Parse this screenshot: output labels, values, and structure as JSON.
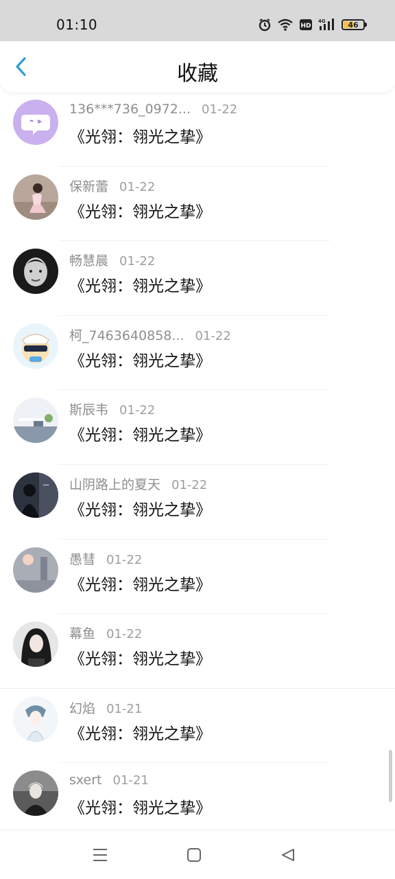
{
  "status_bar": {
    "time": "01:10",
    "battery_level": "46",
    "icons": [
      "alarm-icon",
      "wifi-icon",
      "hd-icon",
      "signal-4g-icon",
      "battery-icon"
    ]
  },
  "header": {
    "title": "收藏",
    "back_icon": "chevron-left-icon",
    "accent_color": "#2d9cdb"
  },
  "list": {
    "items": [
      {
        "name": "136***736_0972...",
        "date": "01-22",
        "work": "《光翎：翎光之挚》"
      },
      {
        "name": "保新蕾",
        "date": "01-22",
        "work": "《光翎：翎光之挚》"
      },
      {
        "name": "畅慧晨",
        "date": "01-22",
        "work": "《光翎：翎光之挚》"
      },
      {
        "name": "柯_7463640858...",
        "date": "01-22",
        "work": "《光翎：翎光之挚》"
      },
      {
        "name": "斯辰韦",
        "date": "01-22",
        "work": "《光翎：翎光之挚》"
      },
      {
        "name": "山阴路上的夏天",
        "date": "01-22",
        "work": "《光翎：翎光之挚》"
      },
      {
        "name": "愚彗",
        "date": "01-22",
        "work": "《光翎：翎光之挚》"
      },
      {
        "name": "幕鱼",
        "date": "01-22",
        "work": "《光翎：翎光之挚》"
      },
      {
        "name": "幻焰",
        "date": "01-21",
        "work": "《光翎：翎光之挚》"
      },
      {
        "name": "sxert",
        "date": "01-21",
        "work": "《光翎：翎光之挚》"
      }
    ]
  },
  "nav_bar": {
    "icons": [
      "menu-icon",
      "home-square-icon",
      "back-triangle-icon"
    ]
  }
}
